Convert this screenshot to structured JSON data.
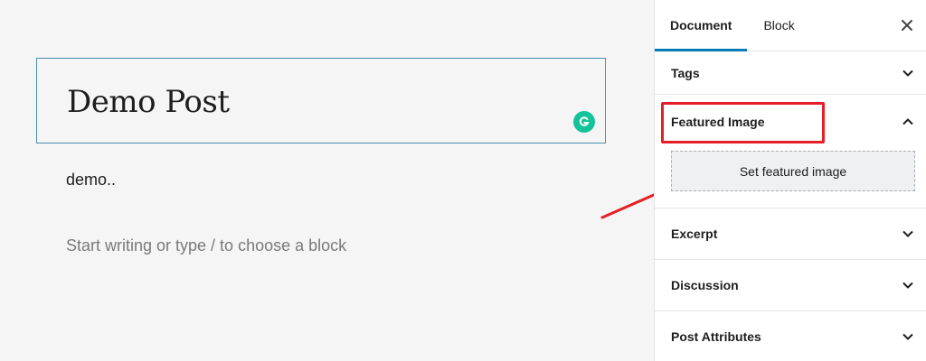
{
  "editor": {
    "title": "Demo Post",
    "paragraph": "demo..",
    "placeholder": "Start writing or type / to choose a block",
    "grammarly_icon": "grammarly-icon"
  },
  "sidebar": {
    "tabs": [
      {
        "label": "Document",
        "active": true
      },
      {
        "label": "Block",
        "active": false
      }
    ],
    "close_icon": "close-icon",
    "panels": [
      {
        "label": "Tags",
        "expanded": false
      },
      {
        "label": "Featured Image",
        "expanded": true,
        "button_label": "Set featured image"
      },
      {
        "label": "Excerpt",
        "expanded": false
      },
      {
        "label": "Discussion",
        "expanded": false
      },
      {
        "label": "Post Attributes",
        "expanded": false
      }
    ]
  },
  "annotation": {
    "highlight_color": "#e41f26",
    "accent": "#007cba"
  }
}
